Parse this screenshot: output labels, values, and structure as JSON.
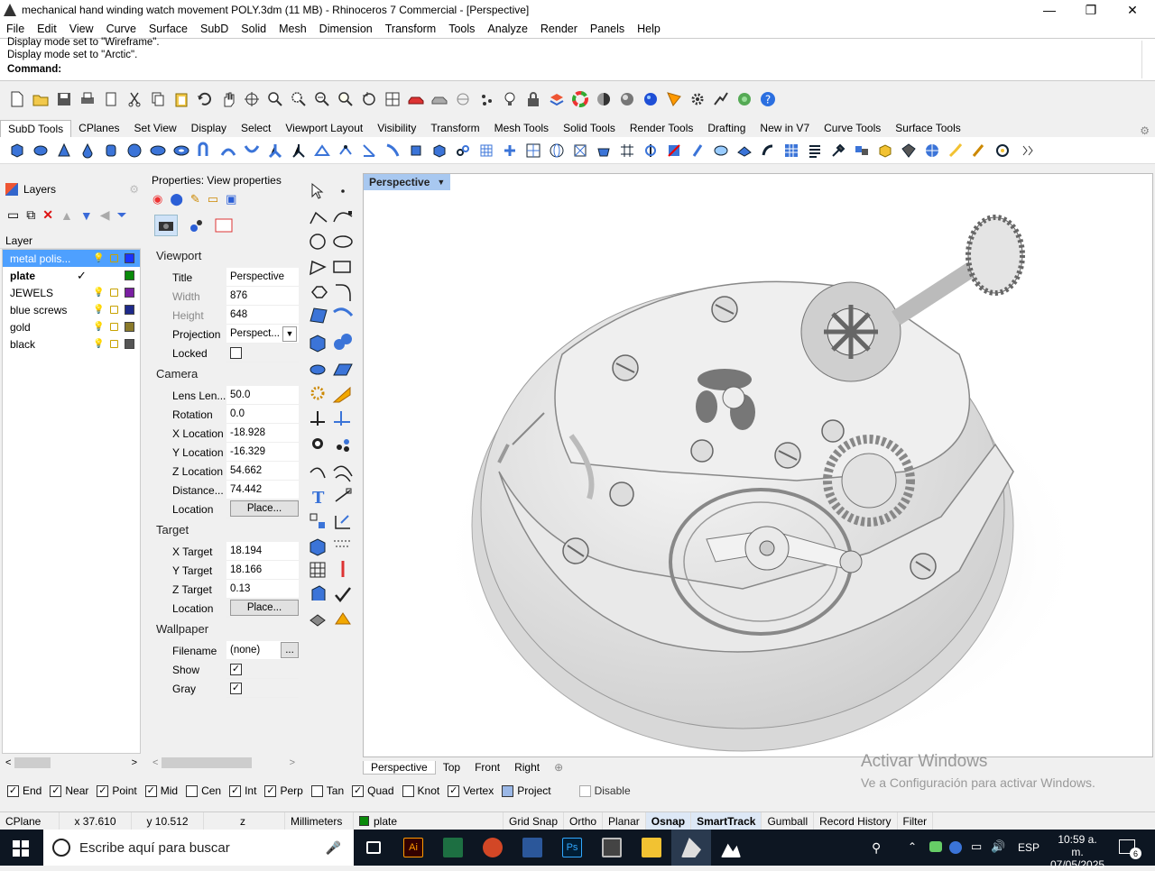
{
  "window": {
    "title": "mechanical hand winding watch movement POLY.3dm (11 MB) - Rhinoceros 7 Commercial - [Perspective]",
    "minimize": "—",
    "maximize": "❐",
    "close": "✕"
  },
  "menu": [
    "File",
    "Edit",
    "View",
    "Curve",
    "Surface",
    "SubD",
    "Solid",
    "Mesh",
    "Dimension",
    "Transform",
    "Tools",
    "Analyze",
    "Render",
    "Panels",
    "Help"
  ],
  "command": {
    "history1": "Display mode set to \"Wireframe\".",
    "history2": "Display mode set to \"Arctic\".",
    "prompt": "Command:"
  },
  "tabs": [
    "SubD Tools",
    "CPlanes",
    "Set View",
    "Display",
    "Select",
    "Viewport Layout",
    "Visibility",
    "Transform",
    "Mesh Tools",
    "Solid Tools",
    "Render Tools",
    "Drafting",
    "New in V7",
    "Curve Tools",
    "Surface Tools"
  ],
  "layers": {
    "panel_title": "Layers",
    "column": "Layer",
    "rows": [
      {
        "name": "metal polis...",
        "color": "#1a33ff",
        "current": false,
        "selected": true
      },
      {
        "name": "plate",
        "color": "#0a8a0a",
        "current": true,
        "selected": false,
        "check": "✓"
      },
      {
        "name": "JEWELS",
        "color": "#7a1fa2",
        "current": false,
        "selected": false
      },
      {
        "name": "blue screws",
        "color": "#1e2a8a",
        "current": false,
        "selected": false
      },
      {
        "name": "gold",
        "color": "#8a7a2a",
        "current": false,
        "selected": false
      },
      {
        "name": "black",
        "color": "#555555",
        "current": false,
        "selected": false
      }
    ]
  },
  "props": {
    "title": "Properties: View properties",
    "viewport": {
      "section": "Viewport",
      "title_lbl": "Title",
      "title_val": "Perspective",
      "width_lbl": "Width",
      "width_val": "876",
      "height_lbl": "Height",
      "height_val": "648",
      "proj_lbl": "Projection",
      "proj_val": "Perspect...",
      "locked_lbl": "Locked"
    },
    "camera": {
      "section": "Camera",
      "lens_lbl": "Lens Len...",
      "lens_val": "50.0",
      "rot_lbl": "Rotation",
      "rot_val": "0.0",
      "xl_lbl": "X Location",
      "xl_val": "-18.928",
      "yl_lbl": "Y Location",
      "yl_val": "-16.329",
      "zl_lbl": "Z Location",
      "zl_val": "54.662",
      "dist_lbl": "Distance...",
      "dist_val": "74.442",
      "loc_lbl": "Location",
      "loc_btn": "Place..."
    },
    "target": {
      "section": "Target",
      "xt_lbl": "X Target",
      "xt_val": "18.194",
      "yt_lbl": "Y Target",
      "yt_val": "18.166",
      "zt_lbl": "Z Target",
      "zt_val": "0.13",
      "loc_lbl": "Location",
      "loc_btn": "Place..."
    },
    "wallpaper": {
      "section": "Wallpaper",
      "file_lbl": "Filename",
      "file_val": "(none)",
      "file_btn": "...",
      "show_lbl": "Show",
      "gray_lbl": "Gray",
      "check": "✓"
    }
  },
  "viewport": {
    "label": "Perspective",
    "tabs": [
      "Perspective",
      "Top",
      "Front",
      "Right"
    ],
    "add": "⊕"
  },
  "watermark": {
    "line1": "Activar Windows",
    "line2": "Ve a Configuración para activar Windows."
  },
  "osnaps": [
    {
      "label": "End",
      "on": true
    },
    {
      "label": "Near",
      "on": true
    },
    {
      "label": "Point",
      "on": true
    },
    {
      "label": "Mid",
      "on": true
    },
    {
      "label": "Cen",
      "on": false
    },
    {
      "label": "Int",
      "on": true
    },
    {
      "label": "Perp",
      "on": true
    },
    {
      "label": "Tan",
      "on": false
    },
    {
      "label": "Quad",
      "on": true
    },
    {
      "label": "Knot",
      "on": false
    },
    {
      "label": "Vertex",
      "on": true
    },
    {
      "label": "Project",
      "on": false
    },
    {
      "label": "Disable",
      "on": false
    }
  ],
  "status": {
    "cplane": "CPlane",
    "x": "x 37.610",
    "y": "y 10.512",
    "z": "z",
    "units": "Millimeters",
    "layer": "plate",
    "grid": "Grid Snap",
    "ortho": "Ortho",
    "planar": "Planar",
    "osnap": "Osnap",
    "smart": "SmartTrack",
    "gumball": "Gumball",
    "history": "Record History",
    "filter": "Filter"
  },
  "taskbar": {
    "search": "Escribe aquí para buscar",
    "lang": "ESP",
    "time": "10:59 a. m.",
    "date": "07/05/2025",
    "notif": "6"
  }
}
